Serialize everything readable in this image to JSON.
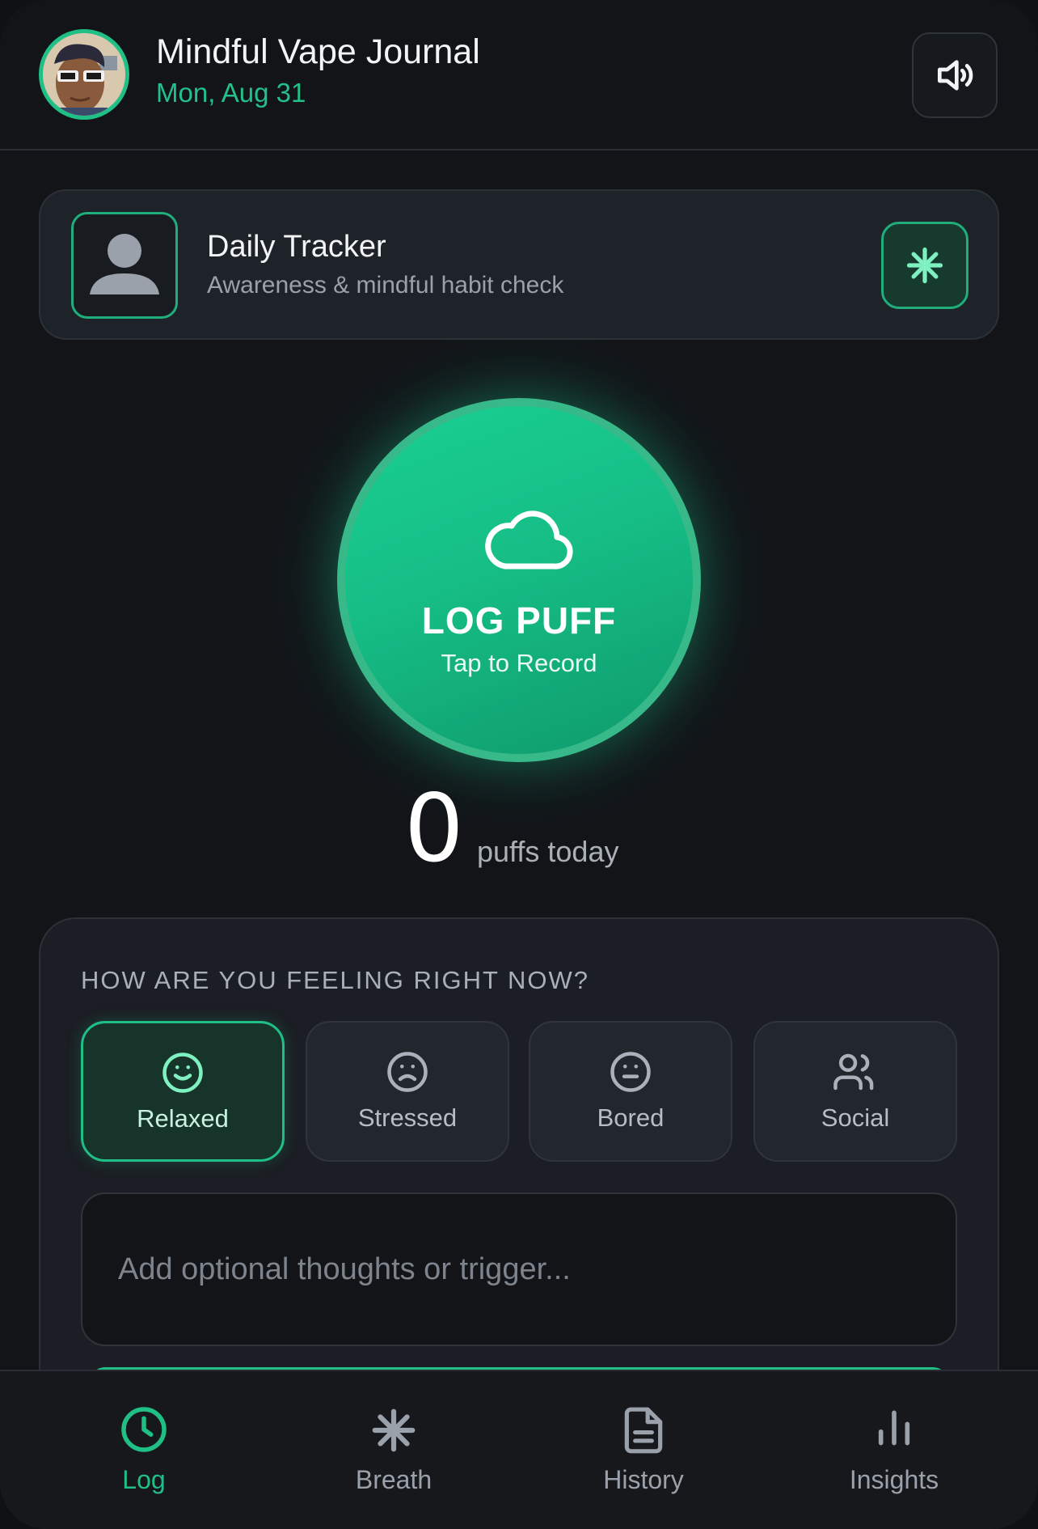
{
  "header": {
    "title": "Mindful Vape Journal",
    "date": "Mon, Aug 31",
    "sound_icon": "speaker-volume-icon"
  },
  "tracker": {
    "title": "Daily Tracker",
    "subtitle": "Awareness & mindful habit check",
    "left_icon": "person-icon",
    "right_icon": "asterisk-icon"
  },
  "log_button": {
    "icon": "cloud-icon",
    "label": "LOG PUFF",
    "sublabel": "Tap to Record"
  },
  "counter": {
    "value": "0",
    "label": "puffs today"
  },
  "feelings": {
    "title": "HOW ARE YOU FEELING RIGHT NOW?",
    "moods": [
      {
        "label": "Relaxed",
        "icon": "smile-icon",
        "selected": true
      },
      {
        "label": "Stressed",
        "icon": "frown-icon",
        "selected": false
      },
      {
        "label": "Bored",
        "icon": "neutral-face-icon",
        "selected": false
      },
      {
        "label": "Social",
        "icon": "users-icon",
        "selected": false
      }
    ],
    "notes_placeholder": "Add optional thoughts or trigger..."
  },
  "nav": {
    "items": [
      {
        "label": "Log",
        "icon": "clock-icon",
        "active": true
      },
      {
        "label": "Breath",
        "icon": "asterisk-icon",
        "active": false
      },
      {
        "label": "History",
        "icon": "document-icon",
        "active": false
      },
      {
        "label": "Insights",
        "icon": "bar-chart-icon",
        "active": false
      }
    ]
  },
  "colors": {
    "accent": "#1fbf86",
    "background": "#121418",
    "card": "#1e2229"
  }
}
